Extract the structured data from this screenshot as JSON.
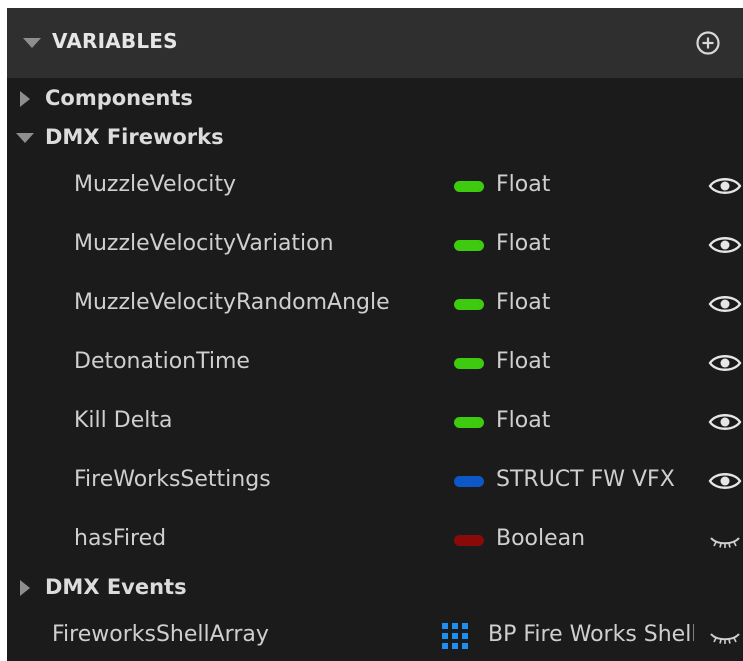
{
  "panel": {
    "header": {
      "title": "VARIABLES",
      "add_icon": "plus-circle-icon"
    },
    "categories": [
      {
        "label": "Components",
        "expanded": false
      },
      {
        "label": "DMX Fireworks",
        "expanded": true
      },
      {
        "label": "DMX Events",
        "expanded": false
      }
    ],
    "variables": [
      {
        "name": "MuzzleVelocity",
        "type": "Float",
        "type_color": "#3ecb0f",
        "visible": true
      },
      {
        "name": "MuzzleVelocityVariation",
        "type": "Float",
        "type_color": "#3ecb0f",
        "visible": true
      },
      {
        "name": "MuzzleVelocityRandomAngle",
        "type": "Float",
        "type_color": "#3ecb0f",
        "visible": true
      },
      {
        "name": "DetonationTime",
        "type": "Float",
        "type_color": "#3ecb0f",
        "visible": true
      },
      {
        "name": "Kill Delta",
        "type": "Float",
        "type_color": "#3ecb0f",
        "visible": true
      },
      {
        "name": "FireWorksSettings",
        "type": "STRUCT FW VFX",
        "type_color": "#0d58c6",
        "visible": true
      },
      {
        "name": "hasFired",
        "type": "Boolean",
        "type_color": "#8a0a0a",
        "visible": false
      }
    ],
    "ungrouped": [
      {
        "name": "FireworksShellArray",
        "type": "BP Fire Works Shell",
        "type_icon": "array-grid-icon",
        "type_color": "#1e8ff0",
        "visible": false
      }
    ]
  }
}
